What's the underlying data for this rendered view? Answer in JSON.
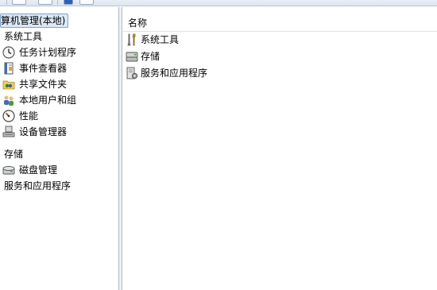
{
  "tree": {
    "root_label": "算机管理(本地)",
    "items": [
      {
        "label": "系统工具",
        "icon": "none"
      },
      {
        "label": "任务计划程序",
        "icon": "clock-icon"
      },
      {
        "label": "事件查看器",
        "icon": "event-viewer-icon"
      },
      {
        "label": "共享文件夹",
        "icon": "shared-folder-icon"
      },
      {
        "label": "本地用户和组",
        "icon": "users-icon"
      },
      {
        "label": "性能",
        "icon": "performance-icon"
      },
      {
        "label": "设备管理器",
        "icon": "device-manager-icon"
      },
      {
        "label": "存储",
        "icon": "none"
      },
      {
        "label": "磁盘管理",
        "icon": "disk-icon"
      },
      {
        "label": "服务和应用程序",
        "icon": "none"
      }
    ]
  },
  "list": {
    "column_name": "名称",
    "items": [
      {
        "label": "系统工具",
        "icon": "tools-icon"
      },
      {
        "label": "存储",
        "icon": "storage-icon"
      },
      {
        "label": "服务和应用程序",
        "icon": "services-icon"
      }
    ]
  }
}
